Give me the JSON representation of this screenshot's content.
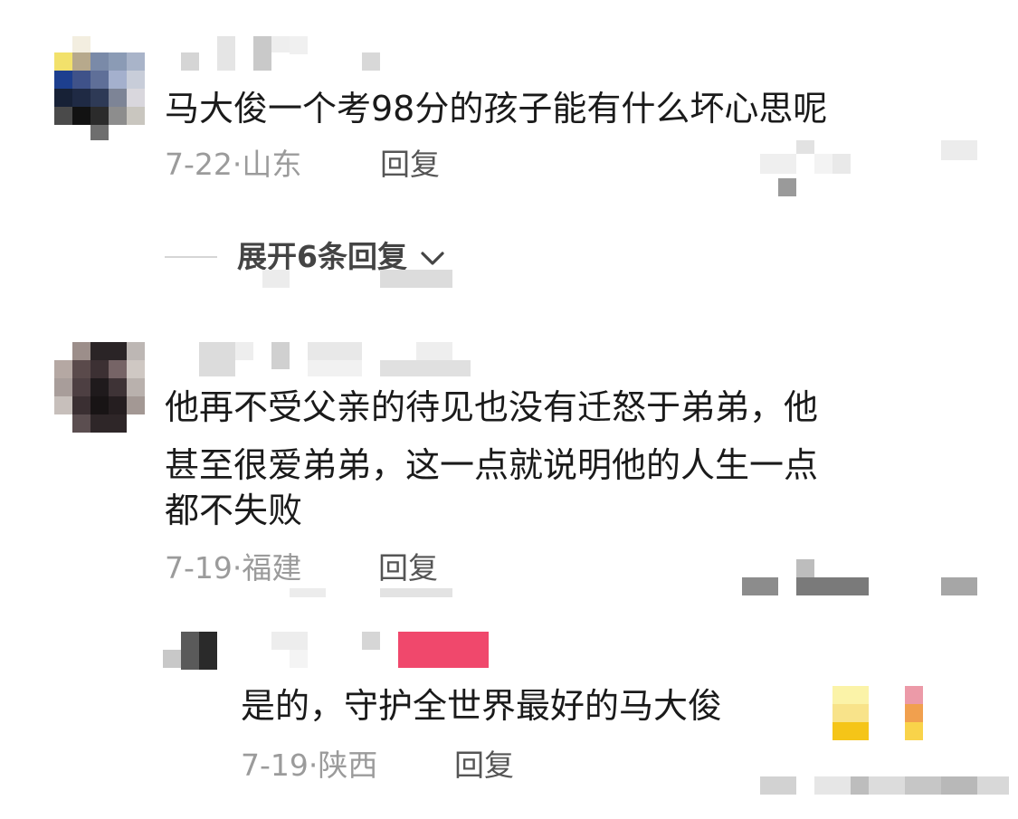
{
  "comments": [
    {
      "text": "马大俊一个考98分的孩子能有什么坏心思呢",
      "date": "7-22",
      "location": "山东",
      "reply_label": "回复",
      "expand_label": "展开6条回复"
    },
    {
      "text_line1": "他再不受父亲的待见也没有迁怒于弟弟，他",
      "text_line2": "甚至很爱弟弟，这一点就说明他的人生一点",
      "text_line3": "都不失败",
      "date": "7-19",
      "location": "福建",
      "reply_label": "回复"
    }
  ],
  "reply": {
    "text": "是的，守护全世界最好的马大俊",
    "date": "7-19",
    "location": "陕西",
    "reply_label": "回复"
  },
  "icons": {
    "chevron": "chevron-down-icon"
  }
}
